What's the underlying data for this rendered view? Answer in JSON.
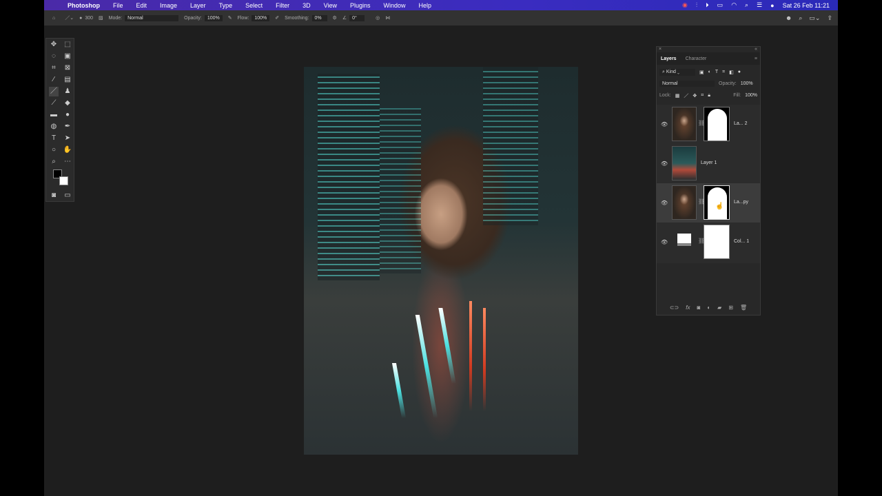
{
  "menubar": {
    "app": "Photoshop",
    "items": [
      "File",
      "Edit",
      "Image",
      "Layer",
      "Type",
      "Select",
      "Filter",
      "3D",
      "View",
      "Plugins",
      "Window",
      "Help"
    ],
    "clock": "Sat 26 Feb  11:21"
  },
  "options": {
    "brush_size": "300",
    "mode_label": "Mode:",
    "mode": "Normal",
    "opacity_label": "Opacity:",
    "opacity": "100%",
    "flow_label": "Flow:",
    "flow": "100%",
    "smoothing_label": "Smoothing:",
    "smoothing": "0%",
    "angle": "0°"
  },
  "panel": {
    "tabs": [
      "Layers",
      "Character"
    ],
    "filter": "Kind",
    "blend": "Normal",
    "opacity_label": "Opacity:",
    "opacity": "100%",
    "lock_label": "Lock:",
    "fill_label": "Fill:",
    "fill": "100%",
    "layers": [
      {
        "name": "La... 2",
        "thumb": "portrait",
        "mask": true
      },
      {
        "name": "Layer 1",
        "thumb": "city",
        "mask": false
      },
      {
        "name": "La...py",
        "thumb": "portrait",
        "mask": true,
        "selected": true
      },
      {
        "name": "Col... 1",
        "thumb": "fill",
        "mask": "white"
      }
    ]
  },
  "colors": {
    "accent": "#3a2cc0",
    "workspace": "#1e1e1e",
    "panel": "#282828"
  }
}
